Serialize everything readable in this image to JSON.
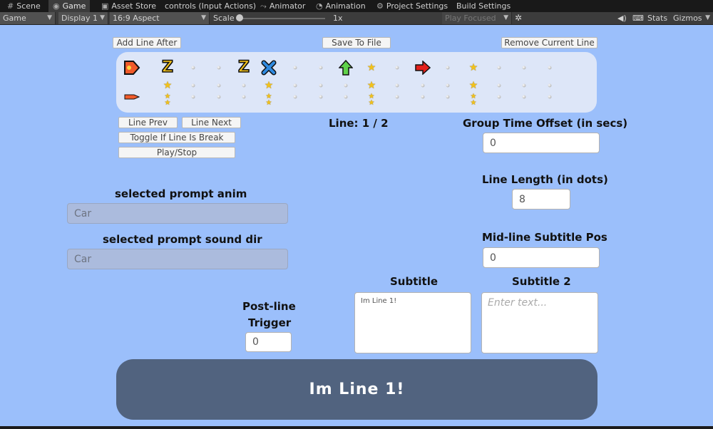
{
  "editor": {
    "tabs": [
      {
        "icon": "#",
        "label": "Scene"
      },
      {
        "icon": "◉",
        "label": "Game"
      },
      {
        "icon": "▣",
        "label": "Asset Store"
      },
      {
        "icon": "",
        "label": "controls (Input Actions)"
      },
      {
        "icon": "⤳",
        "label": "Animator"
      },
      {
        "icon": "◔",
        "label": "Animation"
      },
      {
        "icon": "⚙",
        "label": "Project Settings"
      },
      {
        "icon": "",
        "label": "Build Settings"
      }
    ],
    "toolbar": {
      "view": "Game",
      "display": "Display 1",
      "aspect": "16:9 Aspect",
      "scale_label": "Scale",
      "scale_value": "1x",
      "play_mode": "Play Focused",
      "stats": "Stats",
      "gizmos": "Gizmos"
    }
  },
  "buttons": {
    "add_line_after": "Add Line After",
    "save_to_file": "Save To File",
    "remove_current_line": "Remove Current Line",
    "line_prev": "Line Prev",
    "line_next": "Line Next",
    "toggle_break": "Toggle If Line Is Break",
    "play_stop": "Play/Stop"
  },
  "line_indicator": "Line: 1 / 2",
  "fields": {
    "group_time_offset": {
      "label": "Group Time Offset (in secs)",
      "value": "0"
    },
    "line_length": {
      "label": "Line Length (in dots)",
      "value": "8"
    },
    "midline_subtitle_pos": {
      "label": "Mid-line Subtitle Pos",
      "value": "0"
    },
    "selected_prompt_anim": {
      "label": "selected prompt anim",
      "value": "Car"
    },
    "selected_prompt_sound_dir": {
      "label": "selected prompt sound dir",
      "value": "Car"
    },
    "post_line_trigger": {
      "label_1": "Post-line",
      "label_2": "Trigger",
      "value": "0"
    },
    "subtitle": {
      "label": "Subtitle",
      "value": "Im Line 1!"
    },
    "subtitle_2": {
      "label": "Subtitle 2",
      "placeholder": "Enter text..."
    }
  },
  "colors": {
    "background": "#9bbffb",
    "banner": "#51637f",
    "panel": "#dde6f8"
  },
  "banner_text": "Im Line 1!",
  "prompt_icons": {
    "z": "Z",
    "x": "✖",
    "up": "⬆",
    "right": "➡",
    "star": "★"
  }
}
